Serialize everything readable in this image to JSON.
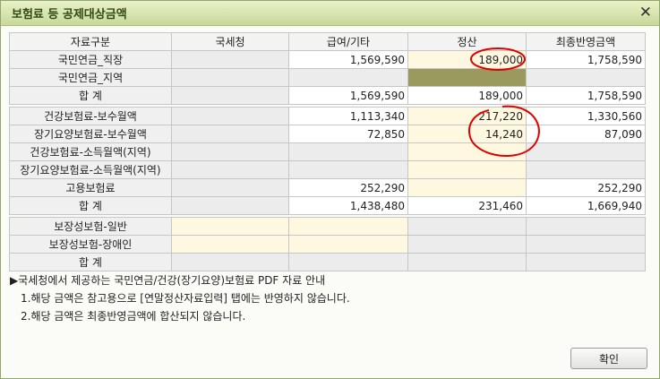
{
  "window": {
    "title": "보험료 등 공제대상금액"
  },
  "table": {
    "headers": [
      "자료구분",
      "국세청",
      "급여/기타",
      "정산",
      "최종반영금액"
    ],
    "rows": [
      {
        "label": "국민연금_직장",
        "c1": "",
        "c2": "1,569,590",
        "c3": "189,000",
        "c4": "1,758,590"
      },
      {
        "label": "국민연금_지역",
        "c1": "",
        "c2": "",
        "c3": "",
        "c4": ""
      },
      {
        "label": "합 계",
        "c1": "",
        "c2": "1,569,590",
        "c3": "189,000",
        "c4": "1,758,590"
      },
      {
        "label": "건강보험료-보수월액",
        "c1": "",
        "c2": "1,113,340",
        "c3": "217,220",
        "c4": "1,330,560"
      },
      {
        "label": "장기요양보험료-보수월액",
        "c1": "",
        "c2": "72,850",
        "c3": "14,240",
        "c4": "87,090"
      },
      {
        "label": "건강보험료-소득월액(지역)",
        "c1": "",
        "c2": "",
        "c3": "",
        "c4": ""
      },
      {
        "label": "장기요양보험료-소득월액(지역)",
        "c1": "",
        "c2": "",
        "c3": "",
        "c4": ""
      },
      {
        "label": "고용보험료",
        "c1": "",
        "c2": "252,290",
        "c3": "",
        "c4": "252,290"
      },
      {
        "label": "합 계",
        "c1": "",
        "c2": "1,438,480",
        "c3": "231,460",
        "c4": "1,669,940"
      },
      {
        "label": "보장성보험-일반",
        "c1": "",
        "c2": "",
        "c3": "",
        "c4": ""
      },
      {
        "label": "보장성보험-장애인",
        "c1": "",
        "c2": "",
        "c3": "",
        "c4": ""
      },
      {
        "label": "합 계",
        "c1": "",
        "c2": "",
        "c3": "",
        "c4": ""
      }
    ]
  },
  "notes": {
    "title": "▶국세청에서 제공하는 국민연금/건강(장기요양)보험료 PDF 자료 안내",
    "line1": "1.해당 금액은 참고용으로 [연말정산자료입력] 탭에는 반영하지 않습니다.",
    "line2": "2.해당 금액은 최종반영금액에 합산되지 않습니다."
  },
  "buttons": {
    "confirm": "확인"
  },
  "colors": {
    "annotation": "#e00000",
    "olive_cell": "#9a9a5e",
    "cream_cell": "#fff8e0"
  },
  "icons": {
    "close": "close-icon"
  }
}
